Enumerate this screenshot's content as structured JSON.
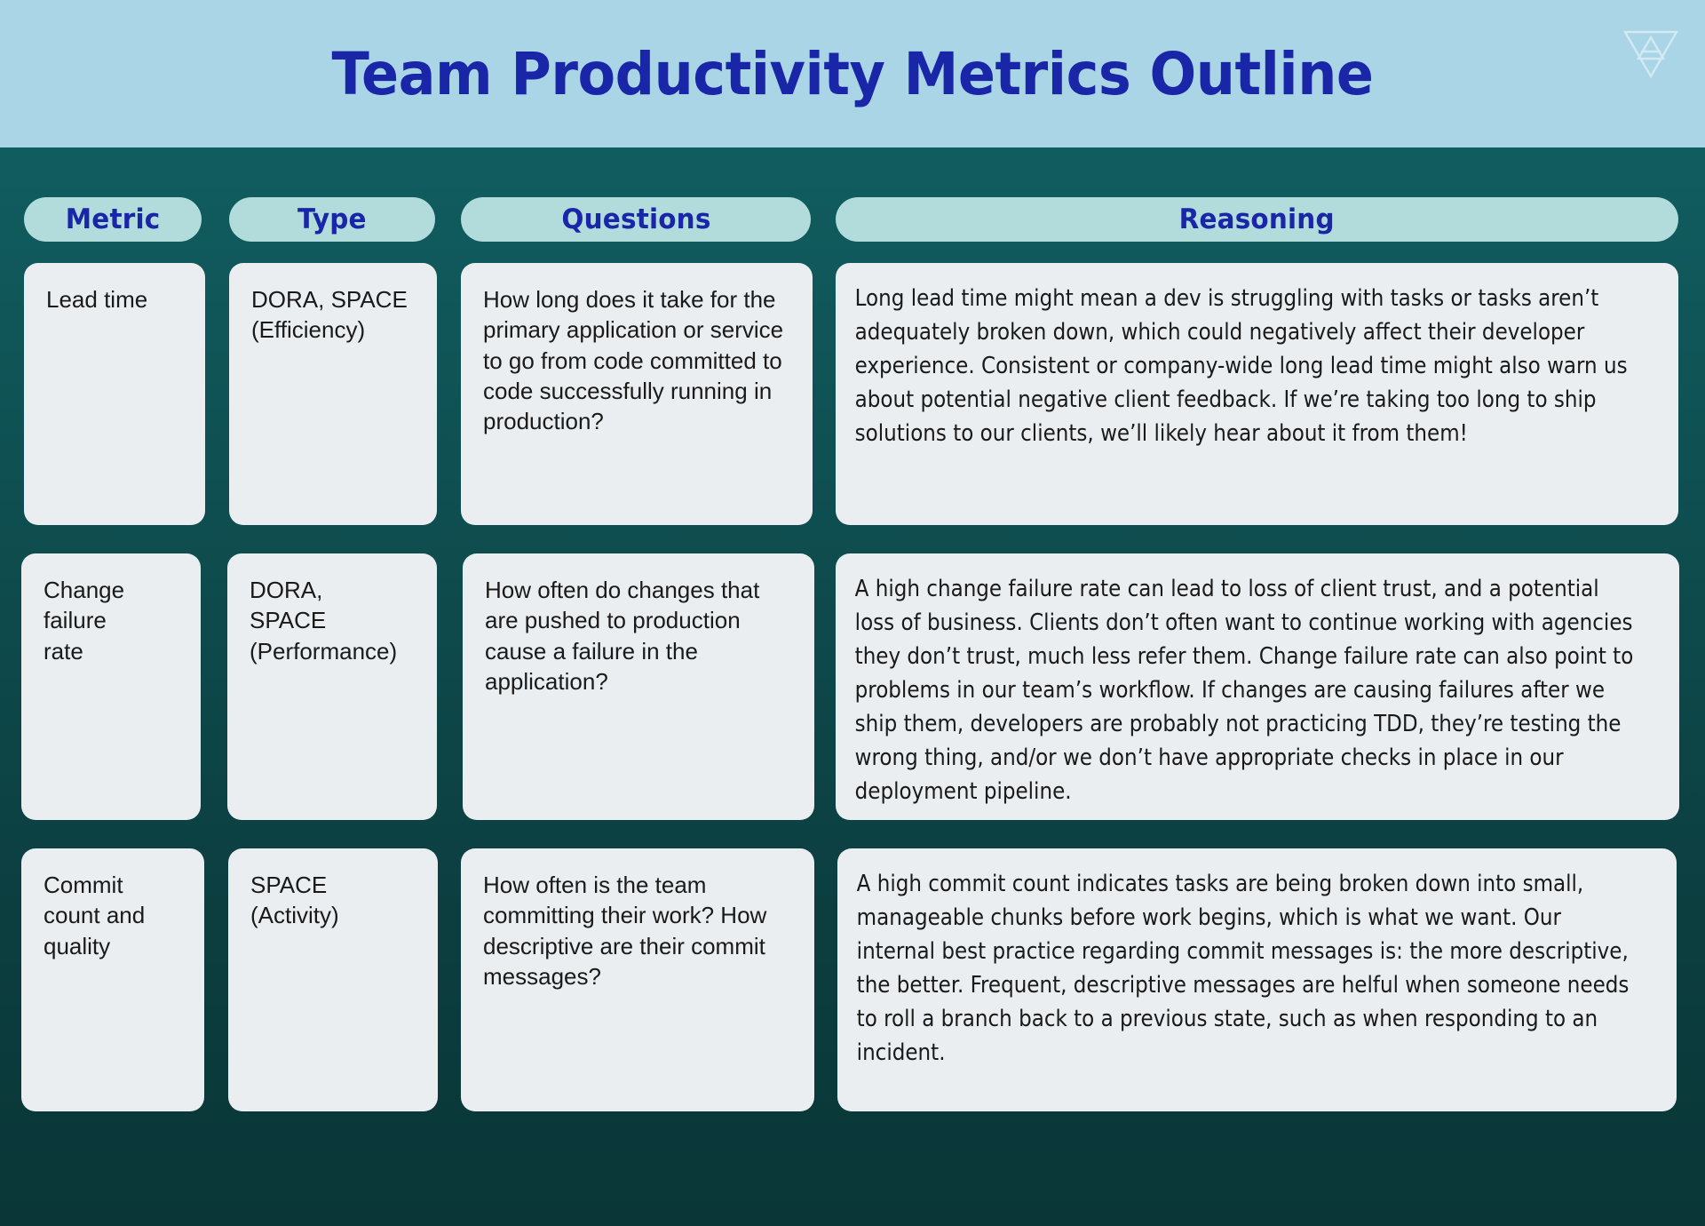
{
  "slide": {
    "title": "Team Productivity Metrics Outline",
    "logo_icon": "inverted-triangle-logo-icon",
    "colors": {
      "title_band": "#a9d5e7",
      "title_text": "#1a26a8",
      "body_background_top": "#116366",
      "body_background_bottom": "#0a3637",
      "header_pill": "#b2dcdc",
      "card": "#eaeef0",
      "card_text": "#1a1a1a"
    }
  },
  "table": {
    "headers": [
      {
        "key": "metric",
        "label": "Metric"
      },
      {
        "key": "type",
        "label": "Type"
      },
      {
        "key": "questions",
        "label": "Questions"
      },
      {
        "key": "reasoning",
        "label": "Reasoning"
      }
    ],
    "rows": [
      {
        "metric": "Lead time",
        "type": "DORA, SPACE\n(Efficiency)",
        "questions": "How long does it take for the primary application or service to go from code committed to code successfully running in production?",
        "reasoning": "Long lead time might mean a dev is struggling with tasks or tasks aren’t adequately broken down, which could negatively affect their developer experience. Consistent or company-wide long lead time might also warn us about potential negative client feedback. If we’re taking too long to ship solutions to our clients, we’ll likely hear about it from them!"
      },
      {
        "metric": "Change\nfailure\nrate",
        "type": "DORA,\nSPACE\n(Performance)",
        "questions": "How often do changes that are pushed to production cause a failure in the application?",
        "reasoning": "A high change failure rate can lead to loss of client trust, and a potential loss of business. Clients don’t often want to continue working with agencies they don’t trust, much less refer them. Change failure rate can also point to problems in our team’s workflow. If changes are causing failures after we ship them, developers are probably not practicing TDD, they’re testing the wrong thing, and/or we don’t have appropriate checks in place in our deployment pipeline."
      },
      {
        "metric": "Commit\ncount and\nquality",
        "type": "SPACE\n(Activity)",
        "questions": "How often is the team committing their work? How descriptive are their commit messages?",
        "reasoning": "A high commit count indicates tasks are being broken down into small, manageable chunks before work begins, which is what we want. Our internal best practice regarding commit messages is: the more descriptive, the better. Frequent, descriptive messages are helful when someone needs to roll a branch back to a previous state, such as when responding to an incident."
      }
    ]
  }
}
